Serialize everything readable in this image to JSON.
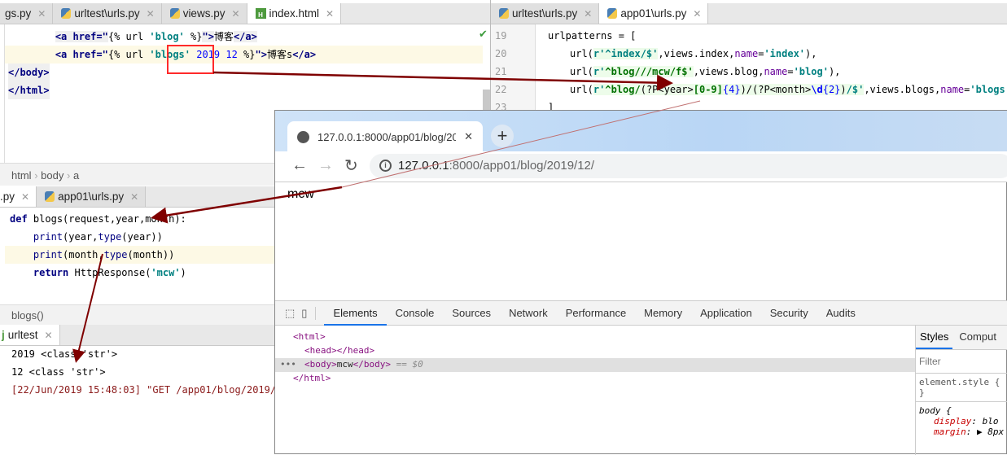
{
  "editor_top_left": {
    "tabs": [
      {
        "label": "gs.py"
      },
      {
        "label": "urltest\\urls.py"
      },
      {
        "label": "views.py"
      },
      {
        "label": "index.html"
      }
    ],
    "lines": [
      {
        "indent": "    ",
        "open": "<a href=\"",
        "tmpl_a": "{% url ",
        "str": "'blog'",
        "tmpl_b": " %}",
        "close": "\">",
        "text": "博客",
        "end": "</a>"
      },
      {
        "indent": "    ",
        "open": "<a href=\"",
        "tmpl_a": "{% url ",
        "str": "'blogs'",
        "args": "2019 12",
        "tmpl_b": " %}",
        "close": "\">",
        "text": "博客s",
        "end": "</a>"
      },
      {
        "tag": "</body>"
      },
      {
        "tag": "</html>"
      }
    ],
    "breadcrumb": [
      "html",
      "body",
      "a"
    ]
  },
  "editor_views": {
    "tabs": [
      {
        "label": ".py"
      },
      {
        "label": "app01\\urls.py"
      }
    ],
    "lines": [
      "def",
      "blogs(request,year,month):",
      "print",
      "(year,",
      "type",
      "(year))",
      "(month,",
      "(month))",
      "return",
      "HttpResponse(",
      "'mcw'",
      ")"
    ],
    "breadcrumb": "blogs()"
  },
  "run": {
    "tab": "urltest",
    "output": [
      "2019 <class 'str'>",
      "12 <class 'str'>",
      "[22/Jun/2019 15:48:03] \"GET /app01/blog/2019/1"
    ]
  },
  "editor_urls": {
    "tabs": [
      {
        "label": "urltest\\urls.py"
      },
      {
        "label": "app01\\urls.py"
      }
    ],
    "line_numbers": [
      "19",
      "20",
      "21",
      "22",
      "23"
    ],
    "l19": "urlpatterns = [",
    "l20": {
      "a": "url(",
      "r": "r'",
      "pat": "^index/$'",
      "b": ",views.index,",
      "kw": "name",
      "eq": "=",
      "val": "'index'",
      "c": "),"
    },
    "l21": {
      "a": "url(",
      "r": "r'",
      "pat": "^blog///mcw/f$'",
      "b": ",views.blog,",
      "kw": "name",
      "eq": "=",
      "val": "'blog'",
      "c": "),"
    },
    "l22": {
      "a": "url(",
      "r": "r'",
      "pat1": "^blog/",
      "grp1": "(?P<year>",
      "cls": "[0-9]",
      "q": "{4}",
      "grp2": ")/(?P<month>",
      "d": "\\d",
      "q2": "{2}",
      "grp3": ")",
      "pat2": "/$'",
      "b": ",views.blogs,",
      "kw": "name",
      "eq": "=",
      "val": "'blogs'",
      "c": ")"
    },
    "l23": "]"
  },
  "browser": {
    "tab_title": "127.0.0.1:8000/app01/blog/20",
    "url_host": "127.0.0.1",
    "url_rest": ":8000/app01/blog/2019/12/",
    "page_text": "mcw",
    "devtools": {
      "tabs": [
        "Elements",
        "Console",
        "Sources",
        "Network",
        "Performance",
        "Memory",
        "Application",
        "Security",
        "Audits"
      ],
      "active_tab": "Elements",
      "dom": [
        "<html>",
        "<head></head>",
        "<body>",
        "mcw",
        "</body>",
        " == $0",
        "</html>"
      ],
      "side_tabs": [
        "Styles",
        "Comput"
      ],
      "filter_placeholder": "Filter",
      "styles": [
        "element.style {",
        "}",
        "body {",
        "display",
        ": blo",
        "margin",
        ": ▶ 8px"
      ]
    }
  },
  "colors": {
    "arrow": "#7f0000",
    "highlight_box": "#ff2a2a",
    "devtools_accent": "#1a73e8"
  }
}
